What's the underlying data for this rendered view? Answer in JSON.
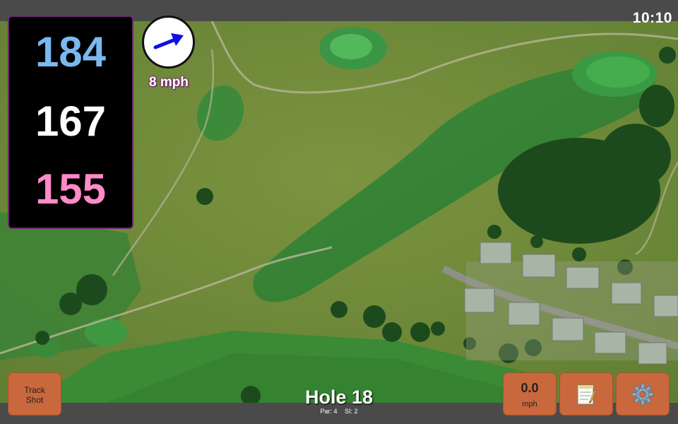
{
  "status_bar": {
    "time": "10:10"
  },
  "distances": {
    "back": "184",
    "middle": "167",
    "front": "155"
  },
  "wind": {
    "speed_label": "8 mph",
    "direction_icon": "arrow-icon",
    "arrow_color": "#1010e0"
  },
  "hole": {
    "title": "Hole 18",
    "par": "Par: 4",
    "stroke_index": "SI: 2"
  },
  "buttons": {
    "track_shot": {
      "line1": "Track",
      "line2": "Shot"
    },
    "speed": {
      "value": "0.0",
      "unit": "mph"
    },
    "notes_icon": "notepad-icon",
    "settings_icon": "gear-icon"
  },
  "colors": {
    "back_distance": "#7ab8f0",
    "middle_distance": "#ffffff",
    "front_distance": "#ff8ac8",
    "button": "#c8683c",
    "panel_border": "#6a2a6a"
  }
}
